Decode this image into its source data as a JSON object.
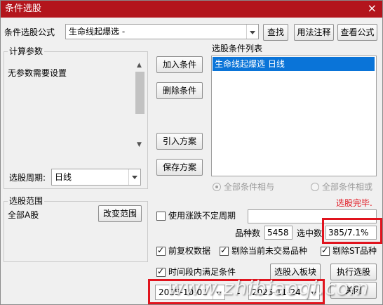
{
  "window": {
    "title": "条件选股",
    "close_symbol": "×"
  },
  "formula": {
    "label": "条件选股公式",
    "value": "生命线起爆选  -",
    "find_button": "查找",
    "usage_button": "用法注释",
    "view_button": "查看公式"
  },
  "params": {
    "group_title": "计算参数",
    "text": "无参数需要设置",
    "period_label": "选股周期:",
    "period_value": "日线"
  },
  "actions": {
    "add": "加入条件",
    "delete": "删除条件",
    "import": "引入方案",
    "save": "保存方案"
  },
  "condition_list": {
    "title": "选股条件列表",
    "items": [
      "生命线起爆选  日线"
    ]
  },
  "logic": {
    "and_label": "全部条件相与",
    "or_label": "全部条件相或"
  },
  "status": {
    "text": "选股完毕.",
    "color": "#e0141e"
  },
  "scope": {
    "group_title": "选股范围",
    "value": "全部A股",
    "change_button": "改变范围"
  },
  "irregular_period": {
    "label": "使用涨跌不定周期",
    "checked": false
  },
  "counts": {
    "total_label": "品种数",
    "total_value": "5458",
    "selected_label": "选中数",
    "selected_value": "385/7.1%"
  },
  "options": {
    "forward_adjust": "前复权数据",
    "exclude_untraded": "剔除当前未交易品种",
    "exclude_st": "剔除ST品种",
    "period_satisfy": "时间段内满足条件"
  },
  "bottom_buttons": {
    "to_block": "选股入板块",
    "execute": "执行选股",
    "close": "关闭"
  },
  "dates": {
    "start": "2025-10-01",
    "separator": "-",
    "end": "2025-11-24"
  },
  "watermark": "www.zhibiaoqi.com",
  "colors": {
    "titlebar": "#b3151c",
    "selection": "#0a74d8",
    "highlight": "#e0141e"
  }
}
